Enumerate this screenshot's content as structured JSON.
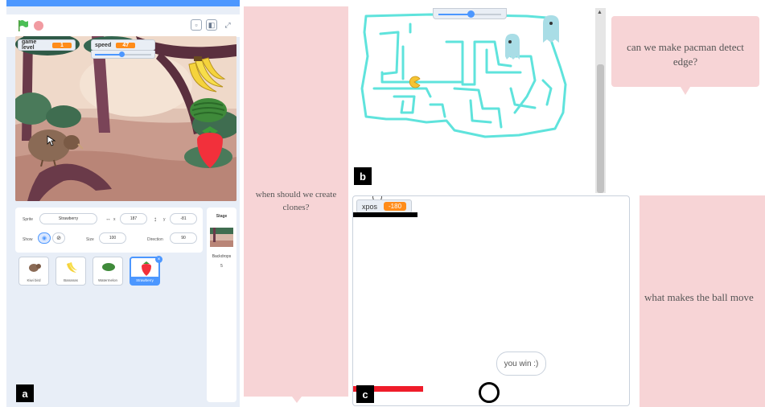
{
  "panel_a": {
    "label": "a",
    "monitors": [
      {
        "label": "game level",
        "value": "1"
      },
      {
        "label": "speed",
        "value": "47"
      }
    ],
    "speed_slider_fraction": 0.47,
    "sprite_info": {
      "sprite_label": "Sprite",
      "sprite_name": "Strawberry",
      "x_label": "x",
      "x_value": "187",
      "y_label": "y",
      "y_value": "-81",
      "show_label": "Show",
      "size_label": "Size",
      "size_value": "100",
      "direction_label": "Direction",
      "direction_value": "90"
    },
    "sprites": [
      {
        "name": "Kiwi bird",
        "selected": false
      },
      {
        "name": "Bananas",
        "selected": false
      },
      {
        "name": "Watermelon",
        "selected": false
      },
      {
        "name": "Strawberry",
        "selected": true
      }
    ],
    "stage_panel": {
      "title": "Stage",
      "backdrops_label": "Backdrops",
      "backdrops_count": "5"
    }
  },
  "panel_b": {
    "label": "b"
  },
  "panel_c": {
    "label": "c",
    "monitor": {
      "label": "xpos",
      "value": "-180"
    },
    "speech": "you win :)"
  },
  "comments": {
    "left": "when should we create clones?",
    "top_right": "can we make pacman detect edge?",
    "bottom_right": "what makes the ball move"
  },
  "colors": {
    "scratch_blue": "#4c97ff",
    "monitor_orange": "#ff8c1a",
    "comment_pink": "#f7d4d6",
    "maze_cyan": "#5fe3dc",
    "paddle_red": "#ef1c2a"
  }
}
